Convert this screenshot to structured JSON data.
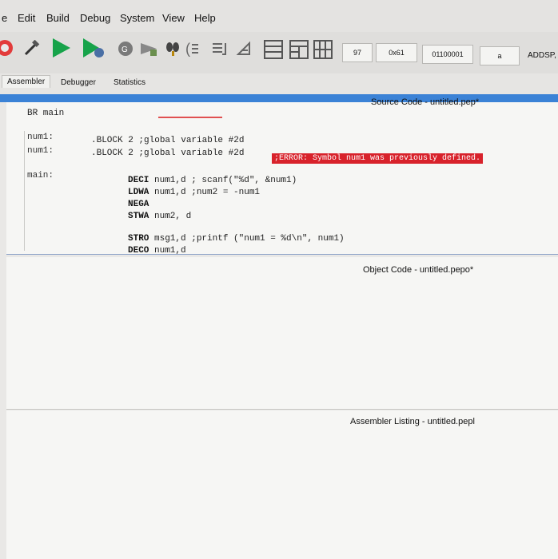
{
  "menu": {
    "items": [
      "e",
      "Edit",
      "Build",
      "Debug",
      "System",
      "View",
      "Help"
    ]
  },
  "toolbar": {
    "decimal_value": "97",
    "hex_value": "0x61",
    "binary_value": "01100001",
    "ascii_value": "a",
    "mnemonic_value": "ADDSP,"
  },
  "tabs": [
    "Assembler",
    "Debugger",
    "Statistics"
  ],
  "source": {
    "title": "Source Code - untitled.pep*",
    "first_line": "BR main",
    "lines": [
      {
        "label": "num1:",
        "code": ".BLOCK 2 ;global variable #2d"
      },
      {
        "label": "num1:",
        "code": ".BLOCK 2 ;global variable #2d"
      }
    ],
    "error": ";ERROR: Symbol num1 was previously defined.",
    "main_label": "main:",
    "main_lines": [
      {
        "op": "DECI",
        "rest": " num1,d ; scanf(\"%d\", &num1)"
      },
      {
        "op": "LDWA",
        "rest": " num1,d ;num2 = -num1"
      },
      {
        "op": "NEGA",
        "rest": ""
      },
      {
        "op": "STWA",
        "rest": " num2, d"
      },
      {
        "op": "STRO",
        "rest": " msg1,d ;printf (\"num1 = %d\\n\", num1)"
      },
      {
        "op": "DECO",
        "rest": " num1,d"
      }
    ]
  },
  "object_code": {
    "title": "Object Code - untitled.pepo*"
  },
  "listing": {
    "title": "Assembler Listing - untitled.pepl"
  },
  "colors": {
    "accent": "#3b82d6",
    "error": "#d8222b"
  }
}
